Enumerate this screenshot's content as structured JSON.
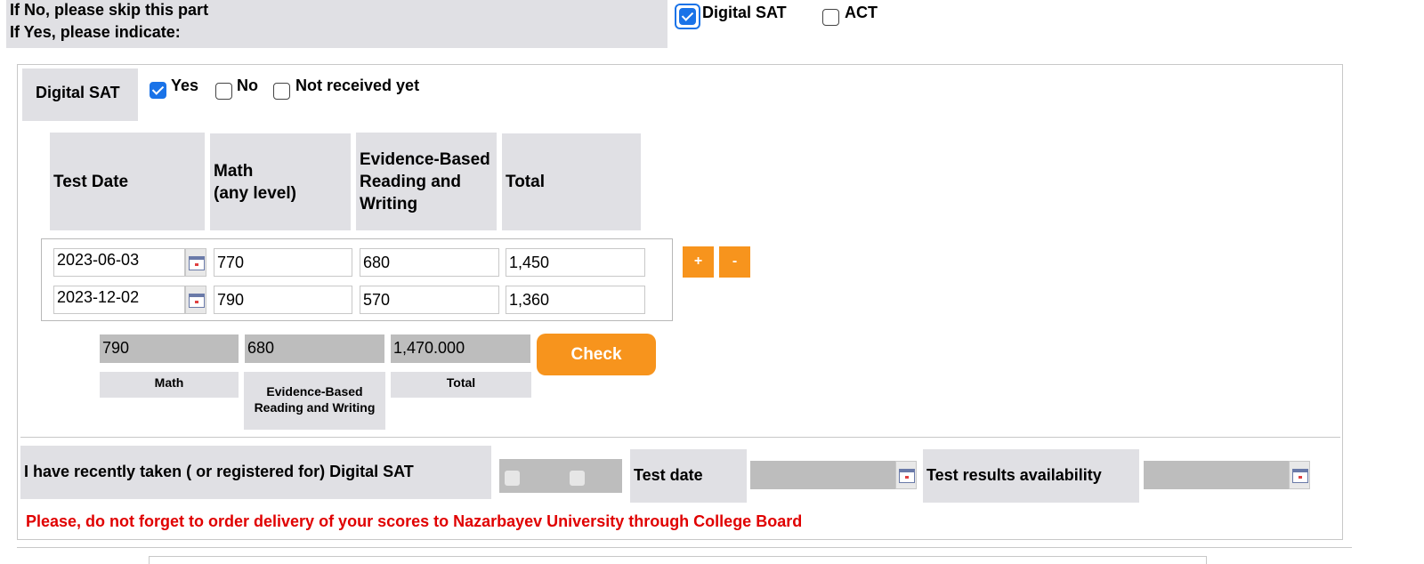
{
  "intro": {
    "line1": "If No, please skip this part",
    "line2": "If Yes, please indicate:"
  },
  "test_types": [
    {
      "label": "Digital SAT",
      "checked": true
    },
    {
      "label": "ACT",
      "checked": false
    }
  ],
  "sat_section": {
    "label": "Digital SAT",
    "received_options": [
      {
        "label": "Yes",
        "checked": true
      },
      {
        "label": "No",
        "checked": false
      },
      {
        "label": "Not received yet",
        "checked": false
      }
    ],
    "columns": [
      "Test Date",
      "Math\n(any level)",
      "Evidence-Based\nReading and\nWriting",
      "Total"
    ],
    "rows": [
      {
        "date": "2023-06-03",
        "math": "770",
        "ebrw": "680",
        "total": "1,450"
      },
      {
        "date": "2023-12-02",
        "math": "790",
        "ebrw": "570",
        "total": "1,360"
      }
    ],
    "add_label": "+",
    "remove_label": "-",
    "superscore": {
      "math": "790",
      "ebrw": "680",
      "total": "1,470.000",
      "math_label": "Math",
      "ebrw_label": "Evidence-Based\nReading and Writing",
      "total_label": "Total"
    },
    "check_label": "Check"
  },
  "recent": {
    "label": "I have recently taken ( or registered for) Digital SAT",
    "test_date_label": "Test date",
    "availability_label": "Test results availability"
  },
  "reminder": {
    "text": "Please, do not forget to order delivery of your scores to Nazarbayev University through College Board",
    "color": "#e00000"
  },
  "accent": "#f7941d"
}
